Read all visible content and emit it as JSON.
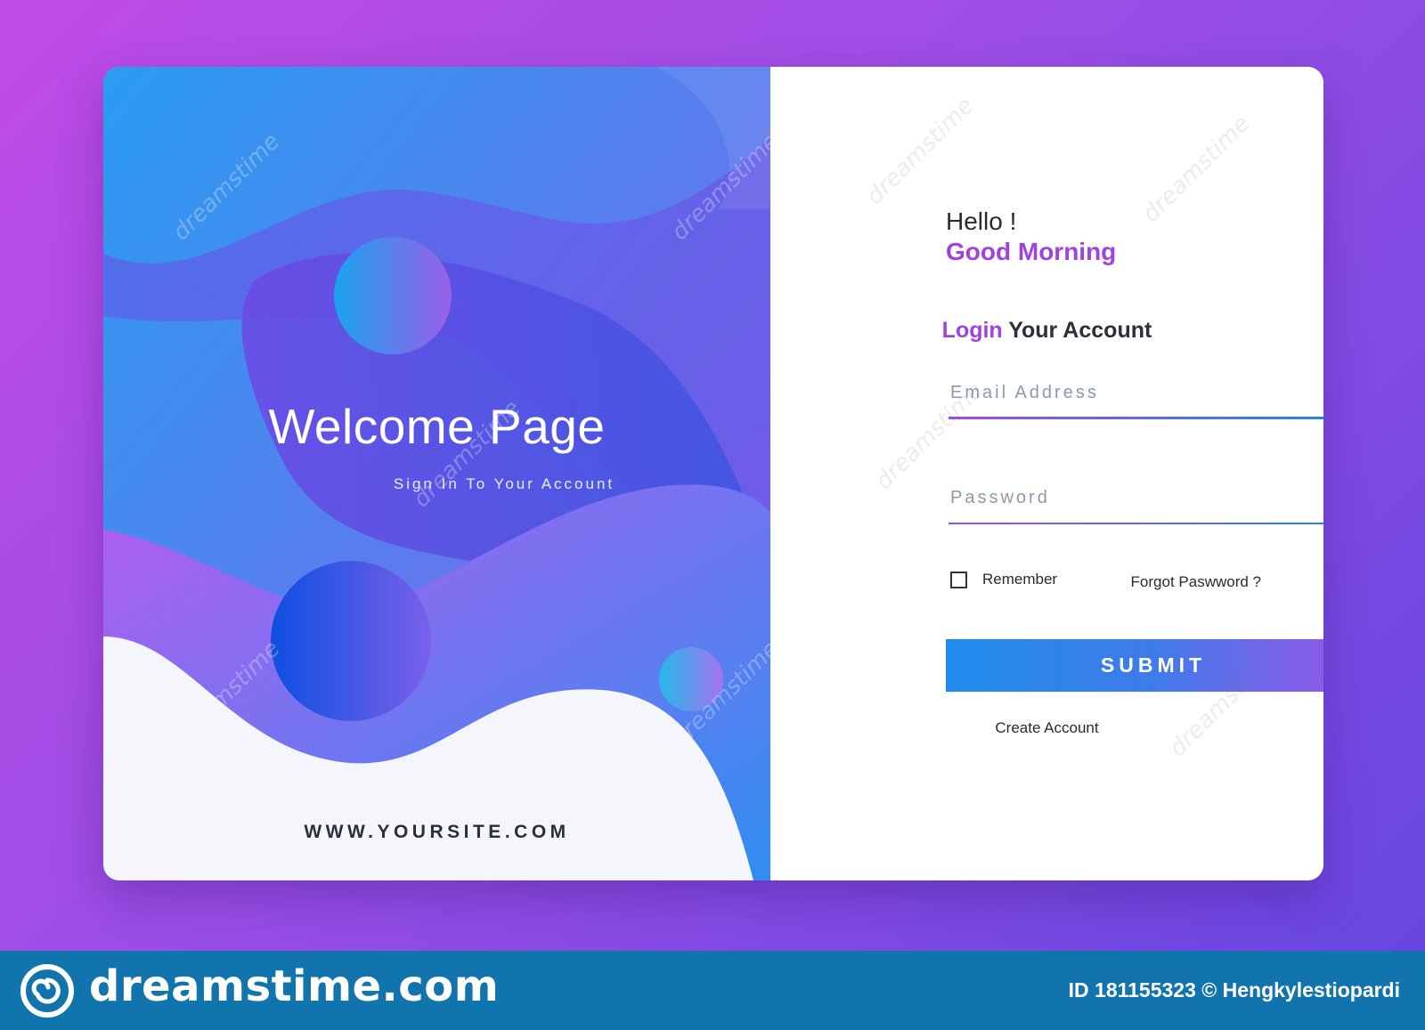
{
  "welcome": {
    "title": "Welcome Page",
    "subtitle": "Sign In To Your Account",
    "site_url": "WWW.YOURSITE.COM"
  },
  "login": {
    "greeting": "Hello !",
    "greeting_sub": "Good Morning",
    "heading_highlight": "Login",
    "heading_rest": " Your Account",
    "email_placeholder": "Email Address",
    "email_value": "",
    "password_placeholder": "Password",
    "password_value": "",
    "remember_label": "Remember",
    "remember_checked": false,
    "forgot_label": "Forgot Paswword ?",
    "submit_label": "SUBMIT",
    "create_account_label": "Create Account"
  },
  "watermark": {
    "text": "dreamstime"
  },
  "footer": {
    "brand": "dreamstime.com",
    "credit": "ID 181155323 © Hengkylestiopardi"
  },
  "colors": {
    "background_start": "#c04be6",
    "background_end": "#6446e0",
    "accent_purple": "#a042e0",
    "accent_blue": "#1e88e5",
    "footer_bar": "#1274ad"
  },
  "icons": {
    "footer_logo": "spiral-logo-icon",
    "checkbox": "checkbox-icon"
  }
}
